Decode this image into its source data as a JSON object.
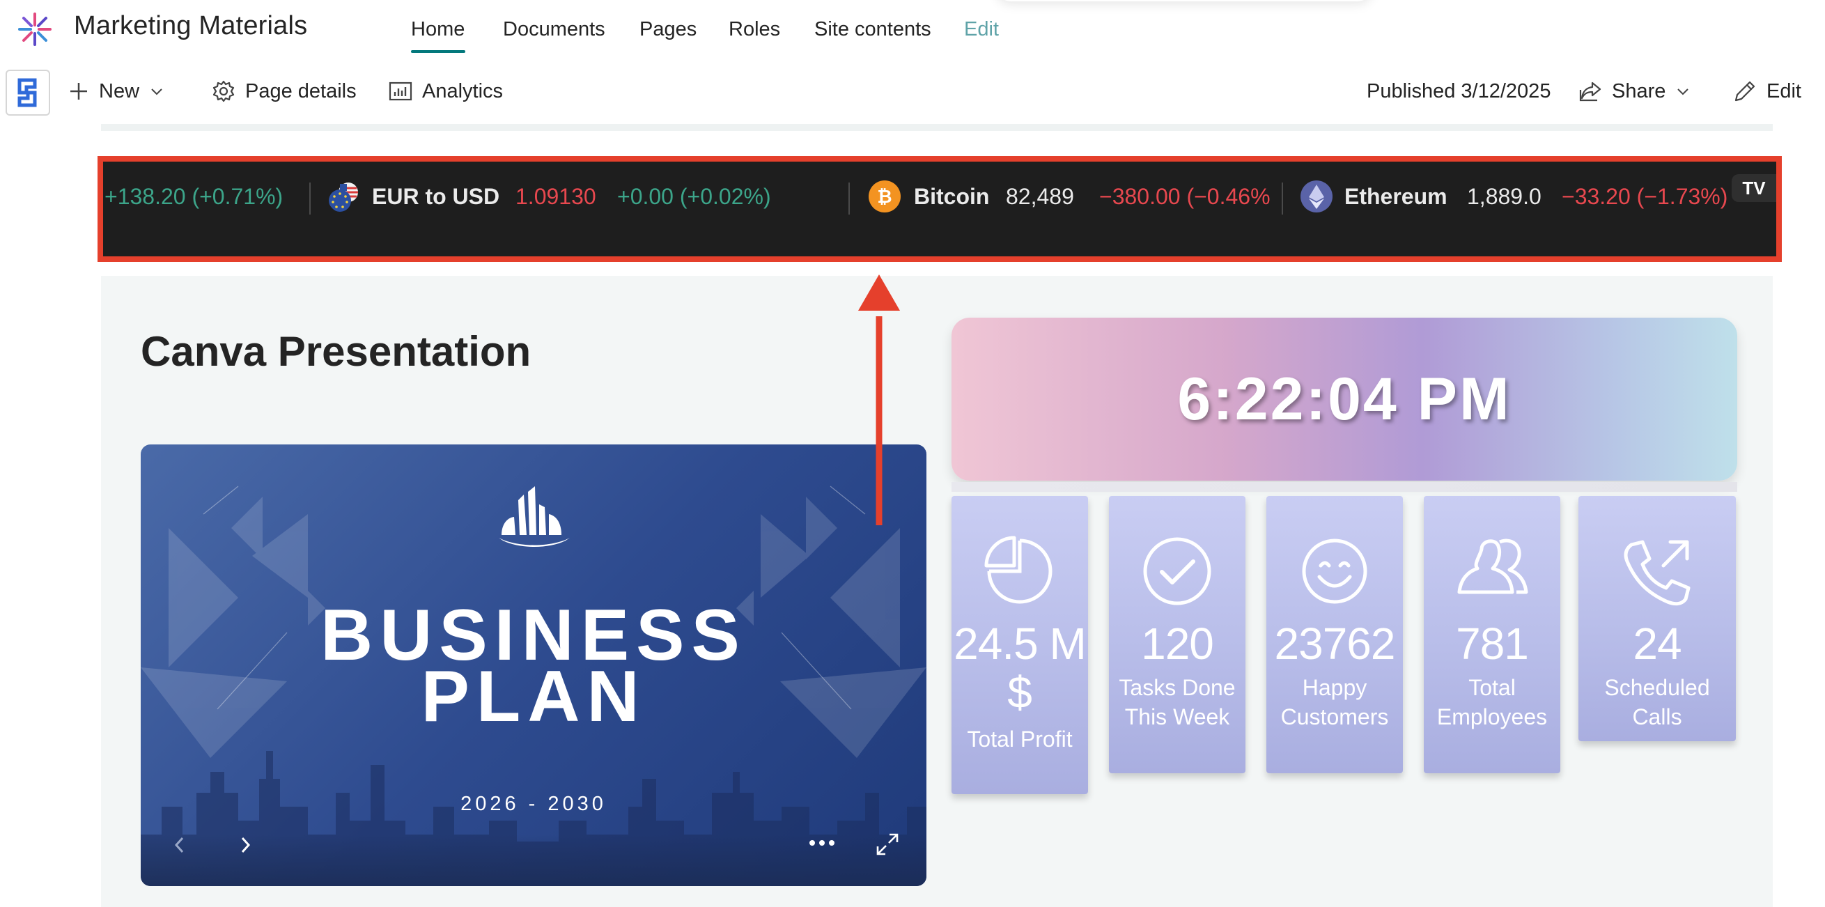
{
  "site": {
    "title": "Marketing Materials",
    "nav": [
      "Home",
      "Documents",
      "Pages",
      "Roles",
      "Site contents",
      "Edit"
    ],
    "active_tab": "Home"
  },
  "command_bar": {
    "new_label": "New",
    "page_details_label": "Page details",
    "analytics_label": "Analytics",
    "published_label": "Published 3/12/2025",
    "share_label": "Share",
    "edit_label": "Edit"
  },
  "ticker": {
    "lead_change": "+138.20 (+0.71%)",
    "items": [
      {
        "name": "EUR to USD",
        "price": "1.09130",
        "change": "+0.00 (+0.02%)",
        "icon": "eur-usd-flag-icon"
      },
      {
        "name": "Bitcoin",
        "price": "82,489",
        "change": "−380.00 (−0.46%",
        "icon": "bitcoin-icon"
      },
      {
        "name": "Ethereum",
        "price": "1,889.0",
        "change": "−33.20 (−1.73%)",
        "icon": "ethereum-icon"
      }
    ],
    "badge": "TV",
    "colors": {
      "positive": "#3ca58a",
      "negative": "#e8484f",
      "price_eur": "#e8484f"
    }
  },
  "presentation": {
    "heading": "Canva Presentation",
    "slide_title_line1": "BUSINESS",
    "slide_title_line2": "PLAN",
    "slide_years": "2026 - 2030"
  },
  "clock": {
    "time": "6:22:04 PM"
  },
  "stats": [
    {
      "value": "24.5 M",
      "value2": "$",
      "label": "Total Profit",
      "icon": "pie-chart-icon"
    },
    {
      "value": "120",
      "label_line1": "Tasks Done",
      "label_line2": "This Week",
      "icon": "checkmark-circle-icon"
    },
    {
      "value": "23762",
      "label_line1": "Happy",
      "label_line2": "Customers",
      "icon": "smiley-icon"
    },
    {
      "value": "781",
      "label_line1": "Total",
      "label_line2": "Employees",
      "icon": "people-icon"
    },
    {
      "value": "24",
      "label": "Scheduled Calls",
      "icon": "outgoing-call-icon"
    }
  ],
  "annotation": {
    "highlight_color": "#e5402c"
  }
}
